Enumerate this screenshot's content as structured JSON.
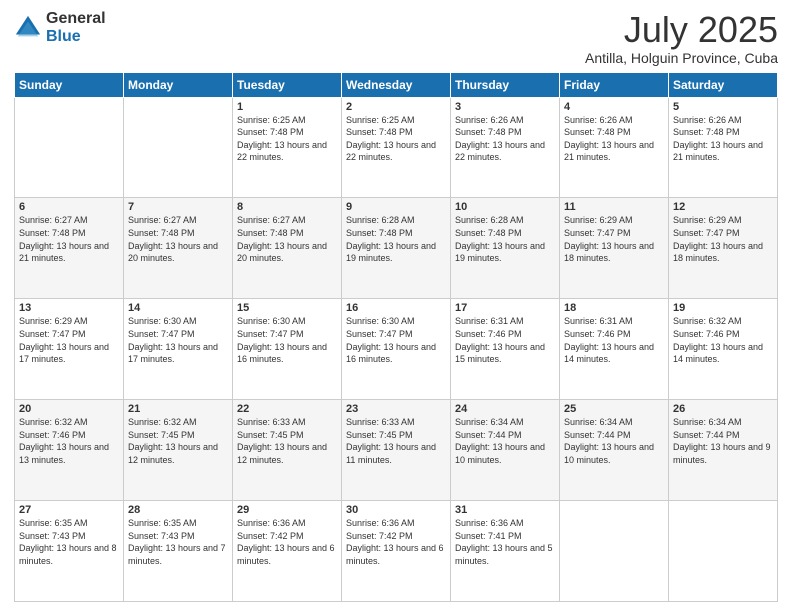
{
  "logo": {
    "general": "General",
    "blue": "Blue"
  },
  "header": {
    "month_year": "July 2025",
    "location": "Antilla, Holguin Province, Cuba"
  },
  "days_of_week": [
    "Sunday",
    "Monday",
    "Tuesday",
    "Wednesday",
    "Thursday",
    "Friday",
    "Saturday"
  ],
  "weeks": [
    [
      {
        "day": "",
        "detail": ""
      },
      {
        "day": "",
        "detail": ""
      },
      {
        "day": "1",
        "detail": "Sunrise: 6:25 AM\nSunset: 7:48 PM\nDaylight: 13 hours and 22 minutes."
      },
      {
        "day": "2",
        "detail": "Sunrise: 6:25 AM\nSunset: 7:48 PM\nDaylight: 13 hours and 22 minutes."
      },
      {
        "day": "3",
        "detail": "Sunrise: 6:26 AM\nSunset: 7:48 PM\nDaylight: 13 hours and 22 minutes."
      },
      {
        "day": "4",
        "detail": "Sunrise: 6:26 AM\nSunset: 7:48 PM\nDaylight: 13 hours and 21 minutes."
      },
      {
        "day": "5",
        "detail": "Sunrise: 6:26 AM\nSunset: 7:48 PM\nDaylight: 13 hours and 21 minutes."
      }
    ],
    [
      {
        "day": "6",
        "detail": "Sunrise: 6:27 AM\nSunset: 7:48 PM\nDaylight: 13 hours and 21 minutes."
      },
      {
        "day": "7",
        "detail": "Sunrise: 6:27 AM\nSunset: 7:48 PM\nDaylight: 13 hours and 20 minutes."
      },
      {
        "day": "8",
        "detail": "Sunrise: 6:27 AM\nSunset: 7:48 PM\nDaylight: 13 hours and 20 minutes."
      },
      {
        "day": "9",
        "detail": "Sunrise: 6:28 AM\nSunset: 7:48 PM\nDaylight: 13 hours and 19 minutes."
      },
      {
        "day": "10",
        "detail": "Sunrise: 6:28 AM\nSunset: 7:48 PM\nDaylight: 13 hours and 19 minutes."
      },
      {
        "day": "11",
        "detail": "Sunrise: 6:29 AM\nSunset: 7:47 PM\nDaylight: 13 hours and 18 minutes."
      },
      {
        "day": "12",
        "detail": "Sunrise: 6:29 AM\nSunset: 7:47 PM\nDaylight: 13 hours and 18 minutes."
      }
    ],
    [
      {
        "day": "13",
        "detail": "Sunrise: 6:29 AM\nSunset: 7:47 PM\nDaylight: 13 hours and 17 minutes."
      },
      {
        "day": "14",
        "detail": "Sunrise: 6:30 AM\nSunset: 7:47 PM\nDaylight: 13 hours and 17 minutes."
      },
      {
        "day": "15",
        "detail": "Sunrise: 6:30 AM\nSunset: 7:47 PM\nDaylight: 13 hours and 16 minutes."
      },
      {
        "day": "16",
        "detail": "Sunrise: 6:30 AM\nSunset: 7:47 PM\nDaylight: 13 hours and 16 minutes."
      },
      {
        "day": "17",
        "detail": "Sunrise: 6:31 AM\nSunset: 7:46 PM\nDaylight: 13 hours and 15 minutes."
      },
      {
        "day": "18",
        "detail": "Sunrise: 6:31 AM\nSunset: 7:46 PM\nDaylight: 13 hours and 14 minutes."
      },
      {
        "day": "19",
        "detail": "Sunrise: 6:32 AM\nSunset: 7:46 PM\nDaylight: 13 hours and 14 minutes."
      }
    ],
    [
      {
        "day": "20",
        "detail": "Sunrise: 6:32 AM\nSunset: 7:46 PM\nDaylight: 13 hours and 13 minutes."
      },
      {
        "day": "21",
        "detail": "Sunrise: 6:32 AM\nSunset: 7:45 PM\nDaylight: 13 hours and 12 minutes."
      },
      {
        "day": "22",
        "detail": "Sunrise: 6:33 AM\nSunset: 7:45 PM\nDaylight: 13 hours and 12 minutes."
      },
      {
        "day": "23",
        "detail": "Sunrise: 6:33 AM\nSunset: 7:45 PM\nDaylight: 13 hours and 11 minutes."
      },
      {
        "day": "24",
        "detail": "Sunrise: 6:34 AM\nSunset: 7:44 PM\nDaylight: 13 hours and 10 minutes."
      },
      {
        "day": "25",
        "detail": "Sunrise: 6:34 AM\nSunset: 7:44 PM\nDaylight: 13 hours and 10 minutes."
      },
      {
        "day": "26",
        "detail": "Sunrise: 6:34 AM\nSunset: 7:44 PM\nDaylight: 13 hours and 9 minutes."
      }
    ],
    [
      {
        "day": "27",
        "detail": "Sunrise: 6:35 AM\nSunset: 7:43 PM\nDaylight: 13 hours and 8 minutes."
      },
      {
        "day": "28",
        "detail": "Sunrise: 6:35 AM\nSunset: 7:43 PM\nDaylight: 13 hours and 7 minutes."
      },
      {
        "day": "29",
        "detail": "Sunrise: 6:36 AM\nSunset: 7:42 PM\nDaylight: 13 hours and 6 minutes."
      },
      {
        "day": "30",
        "detail": "Sunrise: 6:36 AM\nSunset: 7:42 PM\nDaylight: 13 hours and 6 minutes."
      },
      {
        "day": "31",
        "detail": "Sunrise: 6:36 AM\nSunset: 7:41 PM\nDaylight: 13 hours and 5 minutes."
      },
      {
        "day": "",
        "detail": ""
      },
      {
        "day": "",
        "detail": ""
      }
    ]
  ]
}
